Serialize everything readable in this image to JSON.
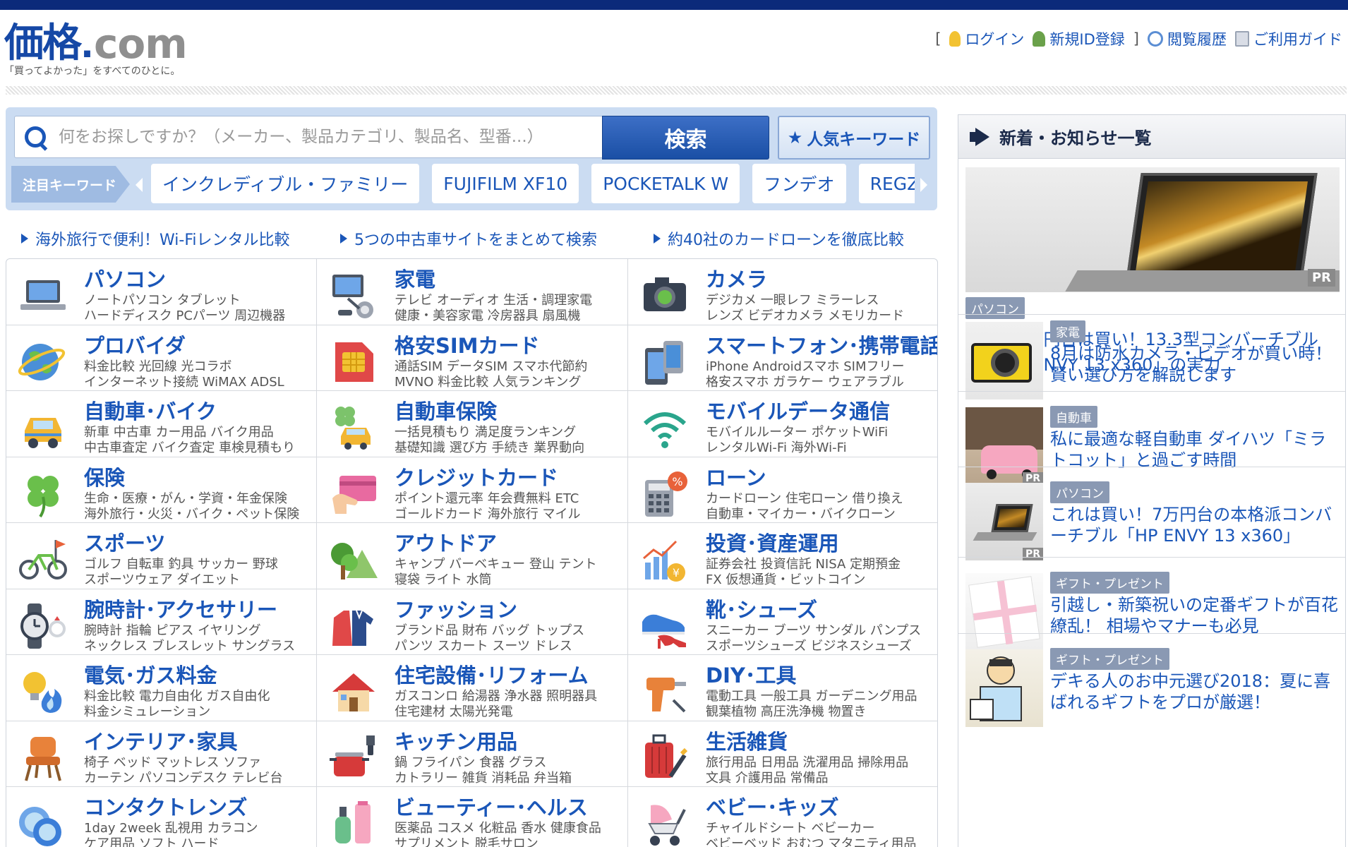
{
  "header": {
    "logo_main": "価格",
    "logo_dot": ".",
    "logo_com": "com",
    "tagline": "「買ってよかった」をすべてのひとに。",
    "links": {
      "bracket_open": "[",
      "login": "ログイン",
      "register": "新規ID登録",
      "bracket_close": "]",
      "history": "閲覧履歴",
      "guide": "ご利用ガイド"
    }
  },
  "search": {
    "placeholder": "何をお探しですか？（メーカー、製品カテゴリ、製品名、型番...）",
    "button": "検索",
    "popular_button": "人気キーワード",
    "keyword_label": "注目キーワード",
    "keywords": [
      "インクレディブル・ファミリー",
      "FUJIFILM XF10",
      "POCKETALK W",
      "フンデオ",
      "REGZA"
    ]
  },
  "promos": [
    "海外旅行で便利！Wi-Fiレンタル比較",
    "5つの中古車サイトをまとめて検索",
    "約40社のカードローンを徹底比較"
  ],
  "categories": [
    {
      "title": "パソコン",
      "sub1": "ノートパソコン タブレット",
      "sub2": "ハードディスク PCパーツ 周辺機器",
      "icon": "laptop-icon"
    },
    {
      "title": "家電",
      "sub1": "テレビ オーディオ 生活・調理家電",
      "sub2": "健康・美容家電 冷房器具 扇風機",
      "icon": "tv-vacuum-icon"
    },
    {
      "title": "カメラ",
      "sub1": "デジカメ 一眼レフ ミラーレス",
      "sub2": "レンズ ビデオカメラ メモリカード",
      "icon": "camera-icon"
    },
    {
      "title": "プロバイダ",
      "sub1": "料金比較 光回線 光コラボ",
      "sub2": "インターネット接続 WiMAX ADSL",
      "icon": "globe-icon"
    },
    {
      "title": "格安SIMカード",
      "sub1": "通話SIM データSIM スマホ代節約",
      "sub2": "MVNO 料金比較 人気ランキング",
      "icon": "sim-card-icon"
    },
    {
      "title": "スマートフォン･携帯電話",
      "sub1": "iPhone Androidスマホ SIMフリー",
      "sub2": "格安スマホ ガラケー ウェアラブル",
      "icon": "smartphone-icon"
    },
    {
      "title": "自動車･バイク",
      "sub1": "新車 中古車 カー用品 バイク用品",
      "sub2": "中古車査定 バイク査定 車検見積もり",
      "icon": "car-icon"
    },
    {
      "title": "自動車保険",
      "sub1": "一括見積もり 満足度ランキング",
      "sub2": "基礎知識 選び方 手続き 業界動向",
      "icon": "car-clover-icon"
    },
    {
      "title": "モバイルデータ通信",
      "sub1": "モバイルルーター ポケットWiFi",
      "sub2": "レンタルWi-Fi 海外Wi-Fi",
      "icon": "wifi-icon"
    },
    {
      "title": "保険",
      "sub1": "生命・医療・がん・学資・年金保険",
      "sub2": "海外旅行・火災・バイク・ペット保険",
      "icon": "clover-icon"
    },
    {
      "title": "クレジットカード",
      "sub1": "ポイント還元率 年会費無料 ETC",
      "sub2": "ゴールドカード 海外旅行 マイル",
      "icon": "credit-card-icon"
    },
    {
      "title": "ローン",
      "sub1": "カードローン 住宅ローン 借り換え",
      "sub2": "自動車・マイカー・バイクローン",
      "icon": "calculator-icon"
    },
    {
      "title": "スポーツ",
      "sub1": "ゴルフ 自転車 釣具 サッカー 野球",
      "sub2": "スポーツウェア ダイエット",
      "icon": "bicycle-icon"
    },
    {
      "title": "アウトドア",
      "sub1": "キャンプ バーベキュー 登山 テント",
      "sub2": "寝袋 ライト 水筒",
      "icon": "tree-mountain-icon"
    },
    {
      "title": "投資･資産運用",
      "sub1": "証券会社 投資信託 NISA 定期預金",
      "sub2": "FX 仮想通貨・ビットコイン",
      "icon": "chart-yen-icon"
    },
    {
      "title": "腕時計･アクセサリー",
      "sub1": "腕時計 指輪 ピアス イヤリング",
      "sub2": "ネックレス ブレスレット サングラス",
      "icon": "watch-icon"
    },
    {
      "title": "ファッション",
      "sub1": "ブランド品 財布 バッグ トップス",
      "sub2": "パンツ スカート スーツ ドレス",
      "icon": "clothes-icon"
    },
    {
      "title": "靴･シューズ",
      "sub1": "スニーカー ブーツ サンダル パンプス",
      "sub2": "スポーツシューズ ビジネスシューズ",
      "icon": "shoes-icon"
    },
    {
      "title": "電気･ガス料金",
      "sub1": "料金比較 電力自由化 ガス自由化",
      "sub2": "料金シミュレーション",
      "icon": "bulb-flame-icon"
    },
    {
      "title": "住宅設備･リフォーム",
      "sub1": "ガスコンロ 給湯器 浄水器 照明器具",
      "sub2": "住宅建材 太陽光発電",
      "icon": "house-icon"
    },
    {
      "title": "DIY･工具",
      "sub1": "電動工具 一般工具 ガーデニング用品",
      "sub2": "観葉植物 高圧洗浄機 物置き",
      "icon": "drill-icon"
    },
    {
      "title": "インテリア･家具",
      "sub1": "椅子 ベッド マットレス ソファ",
      "sub2": "カーテン パソコンデスク テレビ台",
      "icon": "chair-icon"
    },
    {
      "title": "キッチン用品",
      "sub1": "鍋 フライパン 食器 グラス",
      "sub2": "カトラリー 雑貨 消耗品 弁当箱",
      "icon": "pot-icon"
    },
    {
      "title": "生活雑貨",
      "sub1": "旅行用品 日用品 洗濯用品 掃除用品",
      "sub2": "文具 介護用品 常備品",
      "icon": "suitcase-icon"
    },
    {
      "title": "コンタクトレンズ",
      "sub1": "1day 2week 乱視用 カラコン",
      "sub2": "ケア用品 ソフト ハード",
      "icon": "contact-lens-icon"
    },
    {
      "title": "ビューティー･ヘルス",
      "sub1": "医薬品 コスメ 化粧品 香水 健康食品",
      "sub2": "サプリメント 脱毛サロン",
      "icon": "cosmetics-icon"
    },
    {
      "title": "ベビー･キッズ",
      "sub1": "チャイルドシート ベビーカー",
      "sub2": "ベビーベッド おむつ マタニティ用品",
      "icon": "stroller-icon"
    }
  ],
  "news": {
    "title": "新着・お知らせ一覧",
    "hero": {
      "tag": "パソコン",
      "pr": "PR",
      "text": "これで7万円台は買い！13.3型コンバーチブルPC「HP ENVY 13 x360」の実力"
    },
    "items": [
      {
        "tag": "家電",
        "text": "8月は防水カメラ・ビデオが買い時！ 賢い選び方を解説します",
        "pr": ""
      },
      {
        "tag": "自動車",
        "text": "私に最適な軽自動車 ダイハツ「ミラ トコット」と過ごす時間",
        "pr": "PR"
      },
      {
        "tag": "パソコン",
        "text": "これは買い！7万円台の本格派コンバーチブル「HP ENVY 13 x360」",
        "pr": "PR"
      },
      {
        "tag": "ギフト・プレゼント",
        "text": "引越し・新築祝いの定番ギフトが百花繚乱！ 相場やマナーも必見",
        "pr": ""
      },
      {
        "tag": "ギフト・プレゼント",
        "text": "デキる人のお中元選び2018：夏に喜ばれるギフトをプロが厳選！",
        "pr": ""
      }
    ]
  },
  "colors": {
    "brand_blue": "#1a56b8",
    "top_bar": "#0b2a7a",
    "panel": "#cbdcf2"
  }
}
